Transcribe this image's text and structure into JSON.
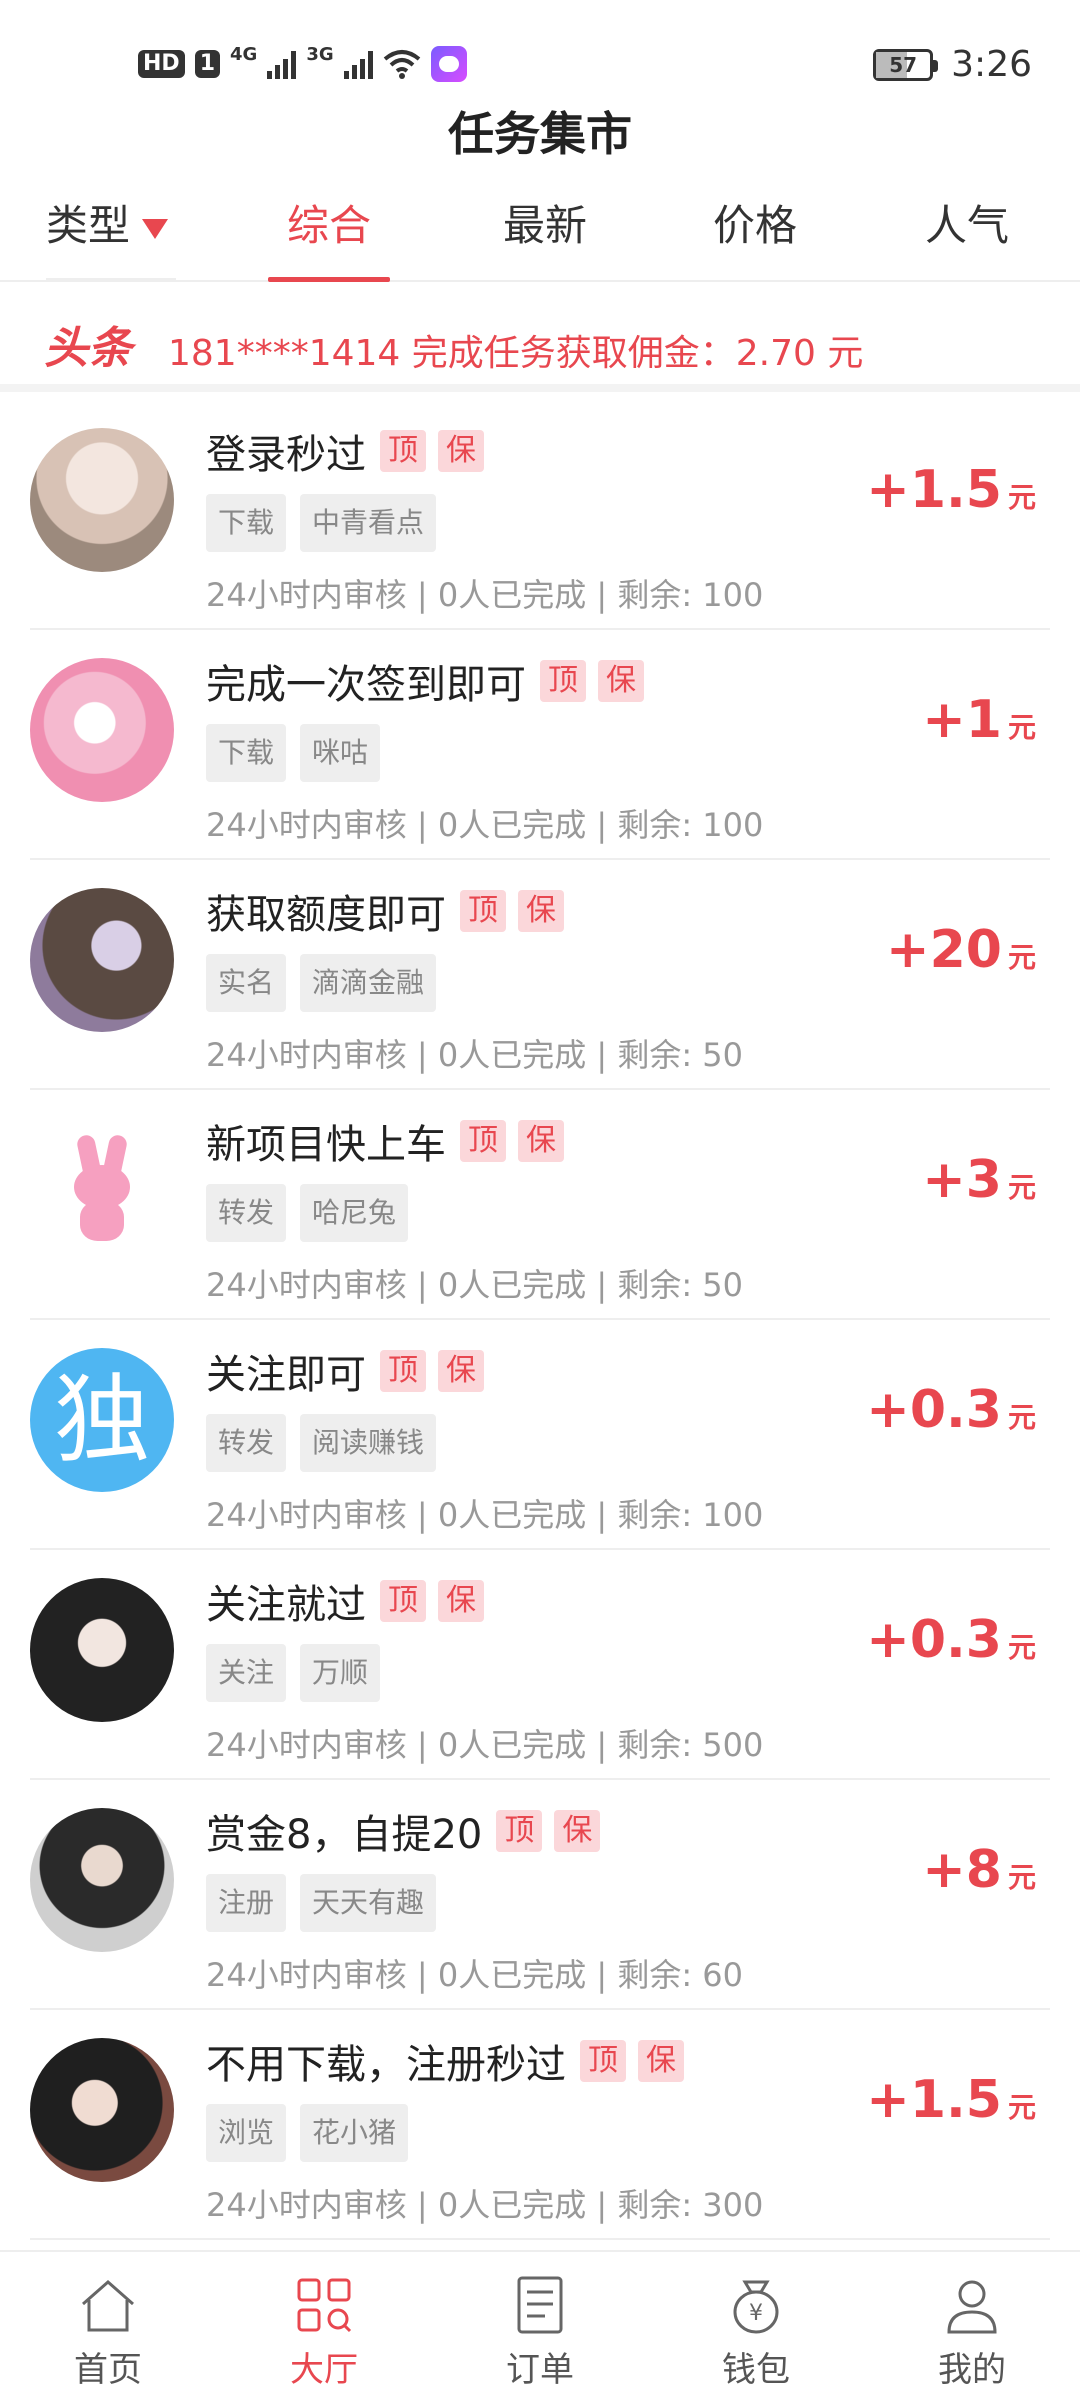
{
  "status_bar": {
    "hd": "HD",
    "sim": "1",
    "net1": "4G",
    "net2": "3G",
    "battery": "57",
    "time": "3:26"
  },
  "title": "任务集市",
  "tabs": {
    "type": "类型",
    "items": [
      "综合",
      "最新",
      "价格",
      "人气"
    ],
    "active": "综合"
  },
  "headline": {
    "tag": "头条",
    "text": "181****1414 完成任务获取佣金：2.70 元"
  },
  "tasks": [
    {
      "title": "登录秒过",
      "badges": [
        "顶",
        "保"
      ],
      "tags": [
        "下载",
        "中青看点"
      ],
      "meta": "24小时内审核 | 0人已完成 | 剩余: 100",
      "price": "+1.5",
      "unit": "元"
    },
    {
      "title": "完成一次签到即可",
      "badges": [
        "顶",
        "保"
      ],
      "tags": [
        "下载",
        "咪咕"
      ],
      "meta": "24小时内审核 | 0人已完成 | 剩余: 100",
      "price": "+1",
      "unit": "元"
    },
    {
      "title": "获取额度即可",
      "badges": [
        "顶",
        "保"
      ],
      "tags": [
        "实名",
        "滴滴金融"
      ],
      "meta": "24小时内审核 | 0人已完成 | 剩余: 50",
      "price": "+20",
      "unit": "元"
    },
    {
      "title": "新项目快上车",
      "badges": [
        "顶",
        "保"
      ],
      "tags": [
        "转发",
        "哈尼兔"
      ],
      "meta": "24小时内审核 | 0人已完成 | 剩余: 50",
      "price": "+3",
      "unit": "元"
    },
    {
      "title": "关注即可",
      "badges": [
        "顶",
        "保"
      ],
      "tags": [
        "转发",
        "阅读赚钱"
      ],
      "meta": "24小时内审核 | 0人已完成 | 剩余: 100",
      "price": "+0.3",
      "unit": "元",
      "avatar_glyph": "独"
    },
    {
      "title": "关注就过",
      "badges": [
        "顶",
        "保"
      ],
      "tags": [
        "关注",
        "万顺"
      ],
      "meta": "24小时内审核 | 0人已完成 | 剩余: 500",
      "price": "+0.3",
      "unit": "元"
    },
    {
      "title": "赏金8，自提20",
      "badges": [
        "顶",
        "保"
      ],
      "tags": [
        "注册",
        "天天有趣"
      ],
      "meta": "24小时内审核 | 0人已完成 | 剩余: 60",
      "price": "+8",
      "unit": "元"
    },
    {
      "title": "不用下载，注册秒过",
      "badges": [
        "顶",
        "保"
      ],
      "tags": [
        "浏览",
        "花小猪"
      ],
      "meta": "24小时内审核 | 0人已完成 | 剩余: 300",
      "price": "+1.5",
      "unit": "元"
    }
  ],
  "bottom_nav": [
    {
      "label": "首页",
      "icon": "home-icon"
    },
    {
      "label": "大厅",
      "icon": "grid-icon",
      "active": true
    },
    {
      "label": "订单",
      "icon": "order-icon"
    },
    {
      "label": "钱包",
      "icon": "wallet-icon"
    },
    {
      "label": "我的",
      "icon": "profile-icon"
    }
  ],
  "colors": {
    "accent": "#e8474f",
    "badge_bg": "#fbd7da",
    "tag_bg": "#eeeeee",
    "meta": "#999999"
  }
}
